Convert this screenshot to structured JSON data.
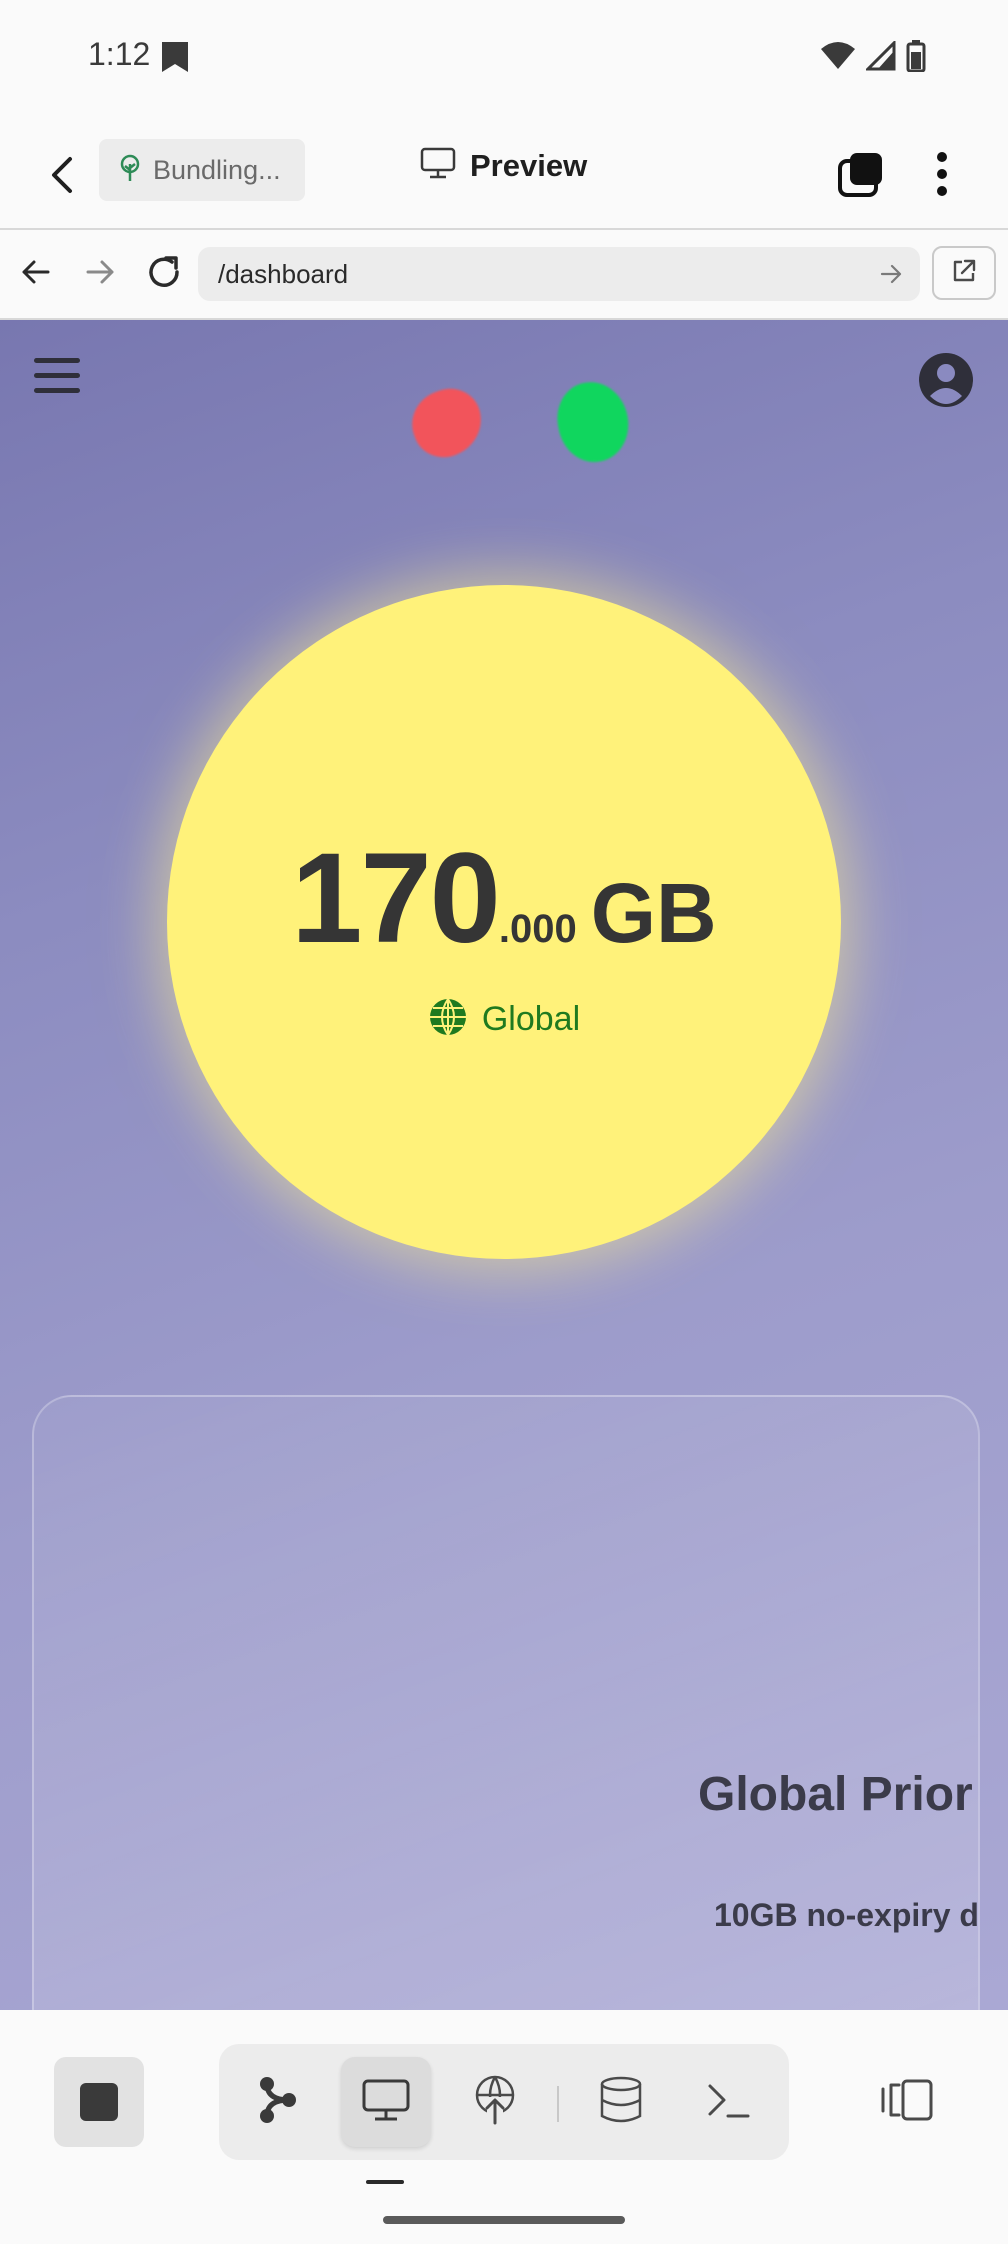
{
  "status_bar": {
    "time": "1:12",
    "icons": [
      "bookmark-icon",
      "wifi-icon",
      "signal-icon",
      "battery-icon"
    ]
  },
  "app_toolbar": {
    "status_chip": "Bundling...",
    "title": "Preview",
    "icons": [
      "back-arrow-icon",
      "sprout-icon",
      "monitor-icon",
      "tabs-icon",
      "more-vert-icon"
    ]
  },
  "browser": {
    "url": "/dashboard",
    "icons": [
      "arrow-left-icon",
      "arrow-right-icon",
      "reload-icon",
      "go-arrow-icon",
      "open-external-icon"
    ]
  },
  "dashboard": {
    "data_amount": {
      "integer": "170",
      "decimal": ".000",
      "unit": "GB"
    },
    "region": "Global",
    "plan_title": "Global Prior",
    "plan_description": "10GB no-expiry d",
    "colors": {
      "circle": "#fff27a",
      "blob_red": "#f2545b",
      "blob_green": "#10d65e",
      "region_text": "#1f7a1f"
    }
  },
  "bottom_bar": {
    "tools": [
      "graph-icon",
      "monitor-icon",
      "deploy-icon",
      "database-icon",
      "terminal-icon"
    ],
    "active_tool": "monitor-icon"
  }
}
